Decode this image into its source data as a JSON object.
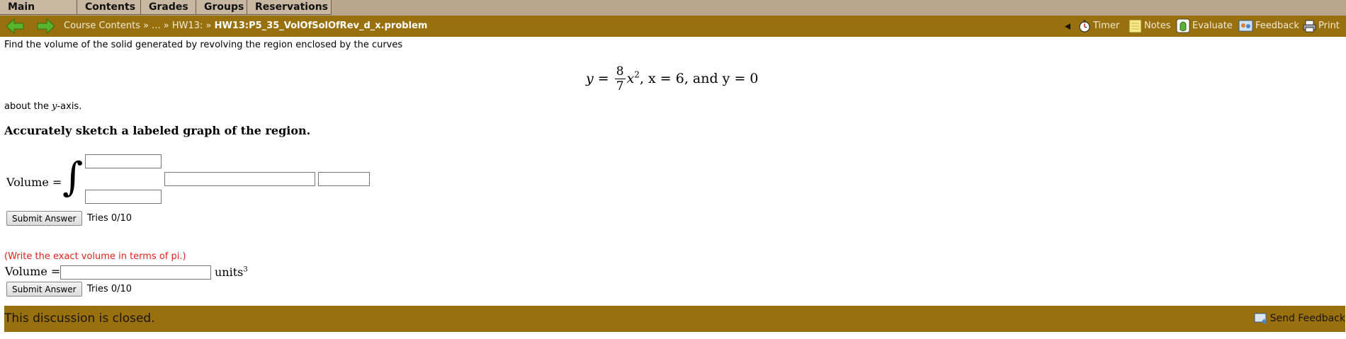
{
  "menu": {
    "items": [
      "Main Menu",
      "Contents",
      "Grades",
      "Groups",
      "Reservations"
    ]
  },
  "nav": {
    "breadcrumb_prefix": "Course Contents » ... » HW13: »",
    "breadcrumb_current": "HW13:P5_35_VolOfSolOfRev_d_x.problem",
    "tools": {
      "timer": "Timer",
      "notes": "Notes",
      "evaluate": "Evaluate",
      "feedback": "Feedback",
      "print": "Print"
    }
  },
  "problem": {
    "intro": "Find the volume of the solid generated by revolving the region enclosed by the curves",
    "equation": {
      "y_eq": "y =",
      "numerator": "8",
      "denominator": "7",
      "after_frac": "x",
      "exponent": "2",
      "rest": ", x = 6, and y = 0"
    },
    "about_prefix": "about the ",
    "about_var": "y",
    "about_suffix": "-axis.",
    "heading": "Accurately sketch a labeled graph of the region.",
    "volume_label": "Volume =",
    "integral_symbol": "∫",
    "submit_label": "Submit Answer",
    "tries": "Tries 0/10",
    "hint": "(Write the exact volume in terms of pi.)",
    "volume_label_2": "Volume =",
    "units": "units",
    "units_exp": "3",
    "submit_label_2": "Submit Answer",
    "tries_2": "Tries 0/10"
  },
  "footer": {
    "closed_text": "This discussion is closed.",
    "send_feedback": "Send Feedback"
  },
  "colors": {
    "menubar": "#b9a68d",
    "navbar": "#98700d",
    "hint": "#e0211b"
  }
}
